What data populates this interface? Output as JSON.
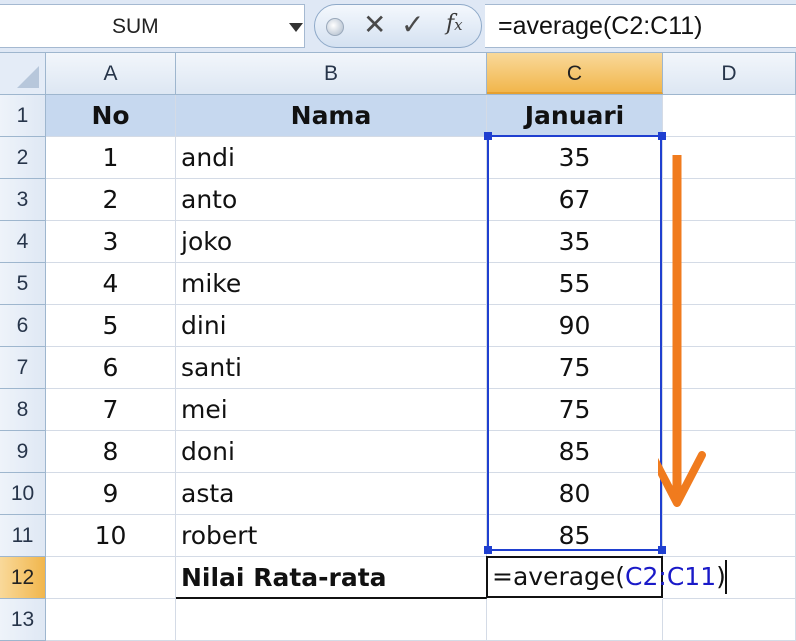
{
  "formula_bar": {
    "name_box": "SUM",
    "formula": "=average(C2:C11)",
    "fx_label": "fx"
  },
  "columns": [
    "A",
    "B",
    "C",
    "D"
  ],
  "rows": [
    "1",
    "2",
    "3",
    "4",
    "5",
    "6",
    "7",
    "8",
    "9",
    "10",
    "11",
    "12",
    "13"
  ],
  "sheet": {
    "header": {
      "no": "No",
      "nama": "Nama",
      "januari": "Januari"
    },
    "data": [
      {
        "no": "1",
        "nama": "andi",
        "januari": "35"
      },
      {
        "no": "2",
        "nama": "anto",
        "januari": "67"
      },
      {
        "no": "3",
        "nama": "joko",
        "januari": "35"
      },
      {
        "no": "4",
        "nama": "mike",
        "januari": "55"
      },
      {
        "no": "5",
        "nama": "dini",
        "januari": "90"
      },
      {
        "no": "6",
        "nama": "santi",
        "januari": "75"
      },
      {
        "no": "7",
        "nama": "mei",
        "januari": "75"
      },
      {
        "no": "8",
        "nama": "doni",
        "januari": "85"
      },
      {
        "no": "9",
        "nama": "asta",
        "januari": "80"
      },
      {
        "no": "10",
        "nama": "robert",
        "januari": "85"
      }
    ],
    "summary_label": "Nilai Rata-rata",
    "editing_formula_prefix": "=average(",
    "editing_formula_ref": "C2:C11",
    "editing_formula_suffix": ")"
  },
  "colors": {
    "selection_border": "#1f3fd0",
    "arrow": "#f07b1e",
    "header_fill": "#c6d8ef",
    "selected_header": "#f1b64c"
  },
  "icons": [
    "cancel-icon",
    "enter-check-icon",
    "function-fx-icon",
    "dropdown-arrow-icon"
  ]
}
